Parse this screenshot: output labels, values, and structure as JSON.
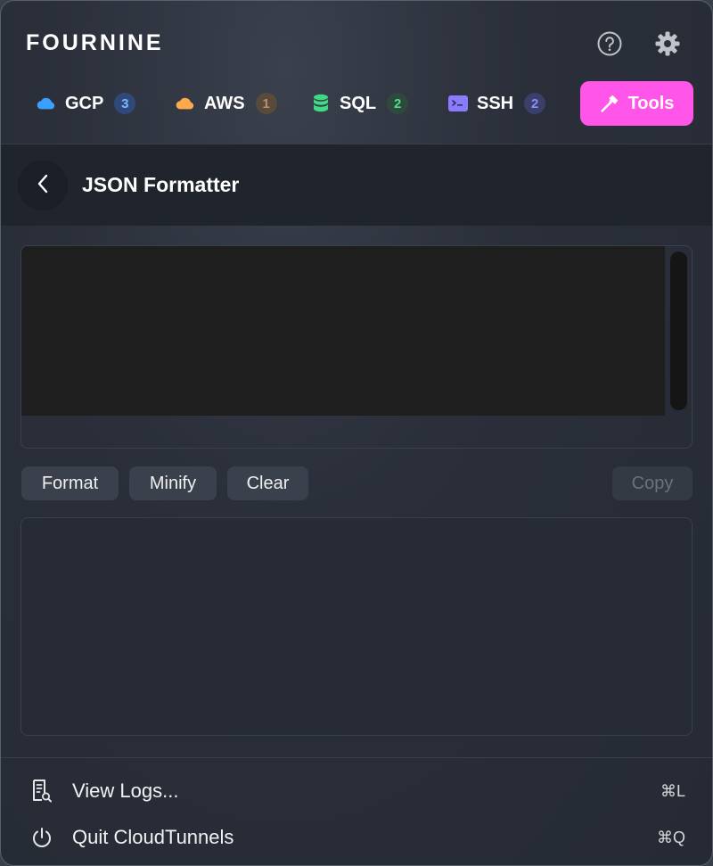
{
  "app": {
    "logo": "FOURNINE"
  },
  "header": {
    "help_icon": "help-circle-icon",
    "settings_icon": "gear-icon"
  },
  "tabs": [
    {
      "id": "gcp",
      "label": "GCP",
      "badge": "3",
      "icon": "cloud-icon",
      "icon_color": "#3aa0ff",
      "badge_bg": "#2f4a7a",
      "badge_color": "#7fb6ff"
    },
    {
      "id": "aws",
      "label": "AWS",
      "badge": "1",
      "icon": "cloud-icon",
      "icon_color": "#ffa94d",
      "badge_bg": "#5a4a3c",
      "badge_color": "#b78f6e"
    },
    {
      "id": "sql",
      "label": "SQL",
      "badge": "2",
      "icon": "database-icon",
      "icon_color": "#3ddc84",
      "badge_bg": "#2f4a3c",
      "badge_color": "#4be08a"
    },
    {
      "id": "ssh",
      "label": "SSH",
      "badge": "2",
      "icon": "terminal-icon",
      "icon_color": "#8b7bff",
      "badge_bg": "#3b3f6a",
      "badge_color": "#8b8fff"
    },
    {
      "id": "tools",
      "label": "Tools",
      "icon": "hammer-icon",
      "active": true,
      "bg": "#ff55e9"
    }
  ],
  "page": {
    "title": "JSON Formatter",
    "back_icon": "chevron-left-icon"
  },
  "input": {
    "value": "",
    "placeholder": ""
  },
  "actions": {
    "format_label": "Format",
    "minify_label": "Minify",
    "clear_label": "Clear",
    "copy_label": "Copy"
  },
  "output": {
    "value": ""
  },
  "footer": {
    "logs": {
      "label": "View Logs...",
      "shortcut": "⌘L",
      "icon": "log-search-icon"
    },
    "quit": {
      "label": "Quit CloudTunnels",
      "shortcut": "⌘Q",
      "icon": "power-icon"
    }
  }
}
